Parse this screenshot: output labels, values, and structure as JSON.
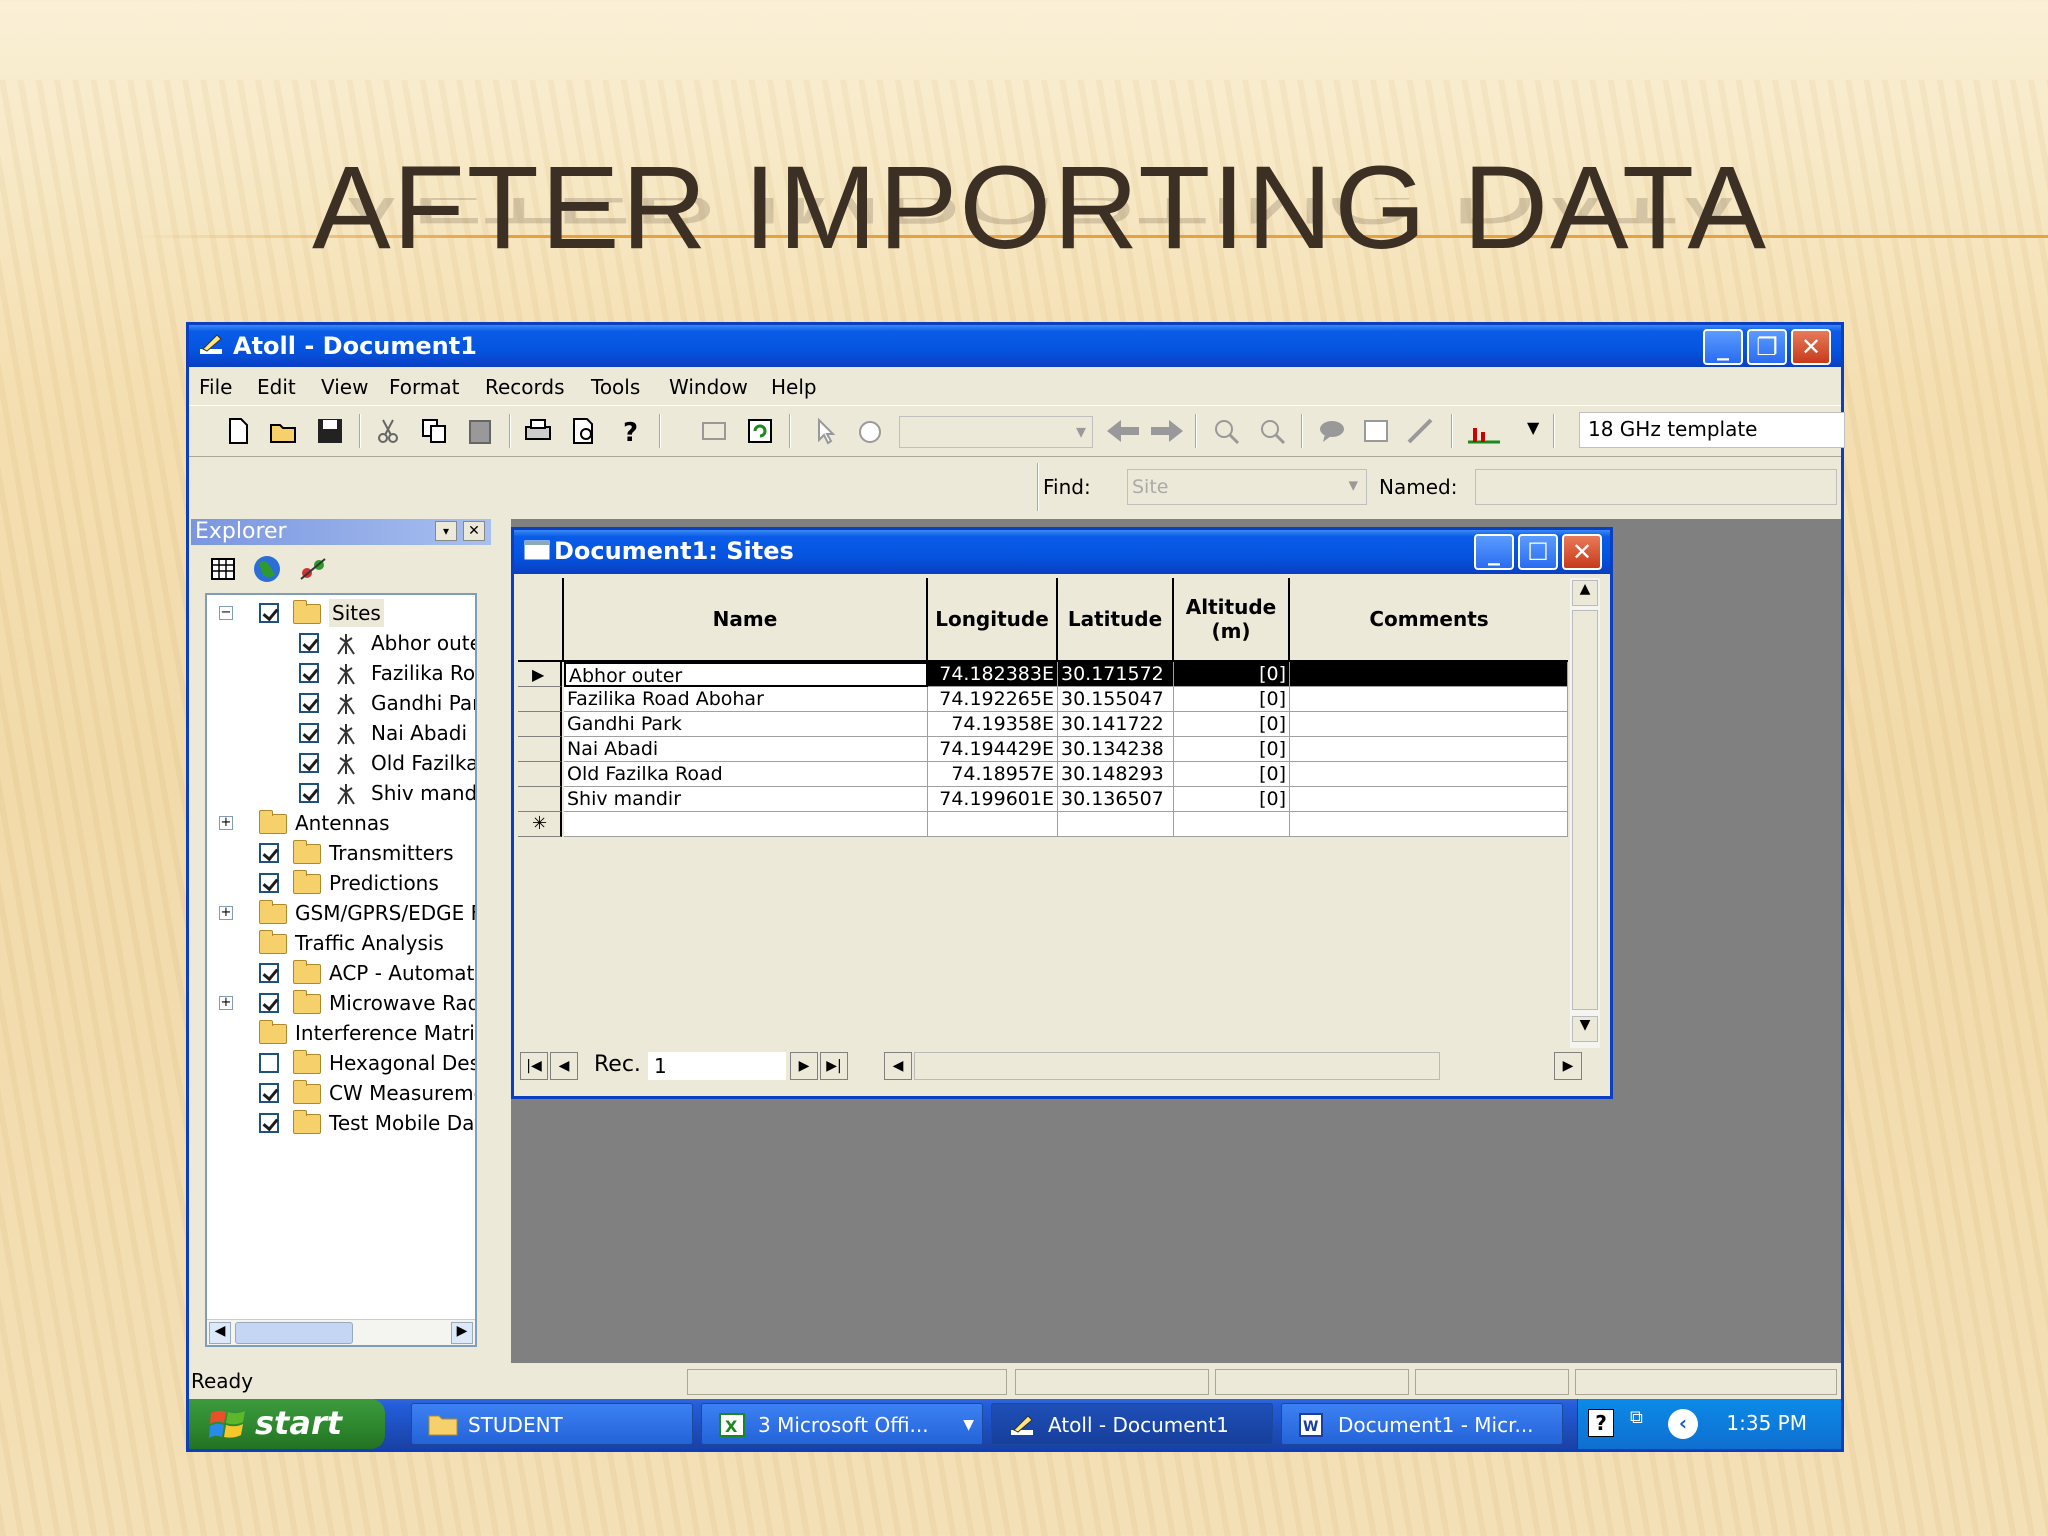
{
  "slide": {
    "title": "AFTER IMPORTING DATA"
  },
  "window": {
    "title": "Atoll - Document1"
  },
  "menu": [
    "File",
    "Edit",
    "View",
    "Format",
    "Records",
    "Tools",
    "Window",
    "Help"
  ],
  "toolbar": {
    "template": "18 GHz template",
    "combo_empty": ""
  },
  "findbar": {
    "find_label": "Find:",
    "find_value": "Site",
    "named_label": "Named:",
    "named_value": ""
  },
  "explorer": {
    "title": "Explorer",
    "root": "Sites",
    "sites": [
      "Abhor oute",
      "Fazilika Roa",
      "Gandhi Parl",
      "Nai Abadi",
      "Old Fazilka",
      "Shiv mandir"
    ],
    "folders": [
      {
        "label": "Antennas",
        "check": null,
        "expand": true
      },
      {
        "label": "Transmitters",
        "check": true,
        "expand": false
      },
      {
        "label": "Predictions",
        "check": true,
        "expand": false
      },
      {
        "label": "GSM/GPRS/EDGE F",
        "check": null,
        "expand": true
      },
      {
        "label": "Traffic Analysis",
        "check": null,
        "expand": false
      },
      {
        "label": "ACP - Automati",
        "check": true,
        "expand": false
      },
      {
        "label": "Microwave Rad",
        "check": true,
        "expand": true
      },
      {
        "label": "Interference Matri",
        "check": null,
        "expand": false
      },
      {
        "label": "Hexagonal Des",
        "check": false,
        "expand": false
      },
      {
        "label": "CW Measureme",
        "check": true,
        "expand": false
      },
      {
        "label": "Test Mobile Dat",
        "check": true,
        "expand": false
      }
    ]
  },
  "sites_window": {
    "title": "Document1: Sites",
    "columns": {
      "name": "Name",
      "longitude": "Longitude",
      "latitude": "Latitude",
      "altitude": "Altitude (m)",
      "comments": "Comments"
    },
    "rows": [
      {
        "name": "Abhor outer",
        "longitude": "74.182383E",
        "latitude": "30.171572",
        "altitude": "[0]",
        "comments": ""
      },
      {
        "name": "Fazilika Road Abohar",
        "longitude": "74.192265E",
        "latitude": "30.155047",
        "altitude": "[0]",
        "comments": ""
      },
      {
        "name": "Gandhi Park",
        "longitude": "74.19358E",
        "latitude": "30.141722",
        "altitude": "[0]",
        "comments": ""
      },
      {
        "name": "Nai Abadi",
        "longitude": "74.194429E",
        "latitude": "30.134238",
        "altitude": "[0]",
        "comments": ""
      },
      {
        "name": "Old Fazilka Road",
        "longitude": "74.18957E",
        "latitude": "30.148293",
        "altitude": "[0]",
        "comments": ""
      },
      {
        "name": "Shiv mandir",
        "longitude": "74.199601E",
        "latitude": "30.136507",
        "altitude": "[0]",
        "comments": ""
      }
    ],
    "rec_label": "Rec.",
    "rec_value": "1"
  },
  "status": {
    "text": "Ready"
  },
  "taskbar": {
    "start": "start",
    "tasks": [
      "STUDENT",
      "3 Microsoft Offi...",
      "Atoll - Document1",
      "Document1 - Micr..."
    ],
    "clock": "1:35 PM"
  },
  "colors": {
    "xp_blue": "#0a3fc2",
    "start_green": "#2f8a2f",
    "title_text": "#3c3025"
  }
}
